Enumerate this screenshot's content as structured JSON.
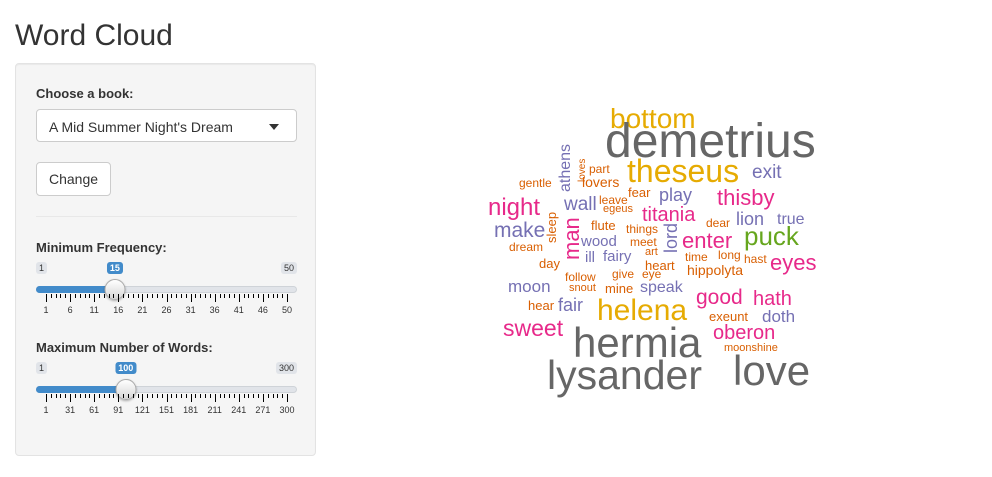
{
  "page": {
    "title": "Word Cloud"
  },
  "sidebar": {
    "book_label": "Choose a book:",
    "book_selected": "A Mid Summer Night's Dream",
    "change_button": "Change",
    "min_freq": {
      "label": "Minimum Frequency:",
      "min": "1",
      "max": "50",
      "value": "15",
      "ticks": [
        "1",
        "6",
        "11",
        "16",
        "21",
        "26",
        "31",
        "36",
        "41",
        "46",
        "50"
      ]
    },
    "max_words": {
      "label": "Maximum Number of Words:",
      "min": "1",
      "max": "300",
      "value": "100",
      "ticks": [
        "1",
        "31",
        "61",
        "91",
        "121",
        "151",
        "181",
        "211",
        "241",
        "271",
        "300"
      ]
    }
  },
  "cloud": {
    "colors": {
      "gray": "#666666",
      "gold": "#e6ab02",
      "pink": "#e7298a",
      "purple": "#7570b3",
      "orange": "#d95f02",
      "green": "#66a61e"
    },
    "words": [
      {
        "text": "bottom",
        "color": "gold"
      },
      {
        "text": "demetrius",
        "color": "gray"
      },
      {
        "text": "theseus",
        "color": "gold"
      },
      {
        "text": "exit",
        "color": "purple"
      },
      {
        "text": "athens",
        "color": "purple"
      },
      {
        "text": "loves",
        "color": "orange"
      },
      {
        "text": "part",
        "color": "orange"
      },
      {
        "text": "gentle",
        "color": "orange"
      },
      {
        "text": "lovers",
        "color": "orange"
      },
      {
        "text": "fear",
        "color": "orange"
      },
      {
        "text": "play",
        "color": "purple"
      },
      {
        "text": "thisby",
        "color": "pink"
      },
      {
        "text": "night",
        "color": "pink"
      },
      {
        "text": "wall",
        "color": "purple"
      },
      {
        "text": "leave",
        "color": "orange"
      },
      {
        "text": "egeus",
        "color": "orange"
      },
      {
        "text": "titania",
        "color": "pink"
      },
      {
        "text": "lion",
        "color": "purple"
      },
      {
        "text": "true",
        "color": "purple"
      },
      {
        "text": "sleep",
        "color": "orange"
      },
      {
        "text": "make",
        "color": "purple"
      },
      {
        "text": "flute",
        "color": "orange"
      },
      {
        "text": "things",
        "color": "orange"
      },
      {
        "text": "dear",
        "color": "orange"
      },
      {
        "text": "man",
        "color": "pink"
      },
      {
        "text": "lord",
        "color": "purple"
      },
      {
        "text": "puck",
        "color": "green"
      },
      {
        "text": "dream",
        "color": "orange"
      },
      {
        "text": "wood",
        "color": "purple"
      },
      {
        "text": "meet",
        "color": "orange"
      },
      {
        "text": "enter",
        "color": "pink"
      },
      {
        "text": "ill",
        "color": "purple"
      },
      {
        "text": "fairy",
        "color": "purple"
      },
      {
        "text": "art",
        "color": "orange"
      },
      {
        "text": "time",
        "color": "orange"
      },
      {
        "text": "long",
        "color": "orange"
      },
      {
        "text": "hast",
        "color": "orange"
      },
      {
        "text": "eyes",
        "color": "pink"
      },
      {
        "text": "day",
        "color": "orange"
      },
      {
        "text": "heart",
        "color": "orange"
      },
      {
        "text": "hippolyta",
        "color": "orange"
      },
      {
        "text": "follow",
        "color": "orange"
      },
      {
        "text": "give",
        "color": "orange"
      },
      {
        "text": "eye",
        "color": "orange"
      },
      {
        "text": "moon",
        "color": "purple"
      },
      {
        "text": "snout",
        "color": "orange"
      },
      {
        "text": "mine",
        "color": "orange"
      },
      {
        "text": "speak",
        "color": "purple"
      },
      {
        "text": "good",
        "color": "pink"
      },
      {
        "text": "hath",
        "color": "pink"
      },
      {
        "text": "hear",
        "color": "orange"
      },
      {
        "text": "fair",
        "color": "purple"
      },
      {
        "text": "helena",
        "color": "gold"
      },
      {
        "text": "exeunt",
        "color": "orange"
      },
      {
        "text": "doth",
        "color": "purple"
      },
      {
        "text": "sweet",
        "color": "pink"
      },
      {
        "text": "oberon",
        "color": "pink"
      },
      {
        "text": "hermia",
        "color": "gray"
      },
      {
        "text": "moonshine",
        "color": "orange"
      },
      {
        "text": "lysander",
        "color": "gray"
      },
      {
        "text": "love",
        "color": "gray"
      }
    ]
  }
}
